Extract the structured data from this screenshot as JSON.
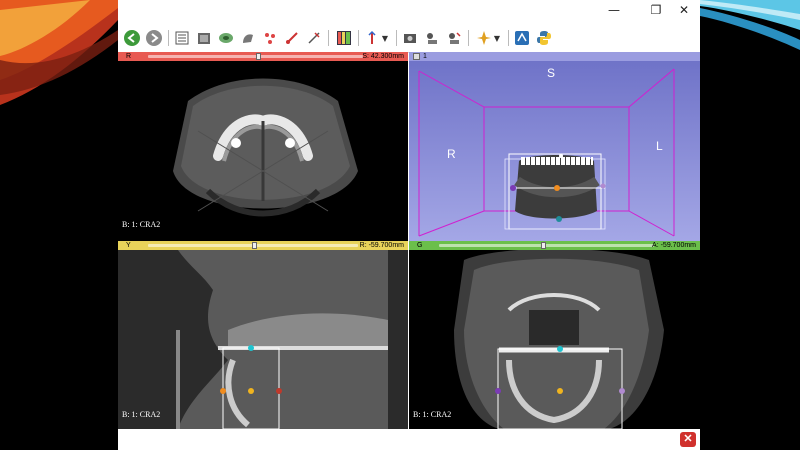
{
  "window": {
    "minimize": "—",
    "maximize": "❐",
    "close": "✕"
  },
  "toolbar": {
    "icons": [
      "back-icon",
      "forward-icon",
      "data-icon",
      "volumes-icon",
      "models-icon",
      "segment-icon",
      "markups-icon",
      "transforms-icon",
      "layout-icon",
      "crosshair-icon",
      "screenshot-icon",
      "scene-view-icon",
      "extensions-icon",
      "python-icon"
    ]
  },
  "views": {
    "red": {
      "tag": "R",
      "value": "S: 42.300mm",
      "bg_label": "B: 1: CRA2",
      "color": "#e85a52"
    },
    "3d": {
      "tag": "1",
      "color": "#9a9ce0",
      "orient": {
        "superior": "S",
        "right": "R",
        "left": "L"
      }
    },
    "yellow": {
      "tag": "Y",
      "value": "R: -59.700mm",
      "bg_label": "B: 1: CRA2",
      "color": "#e8d35a"
    },
    "green": {
      "tag": "G",
      "value": "A: -59.700mm",
      "bg_label": "B: 1: CRA2",
      "color": "#6bbf4a"
    }
  },
  "footer": {
    "close_icon": "✕"
  }
}
